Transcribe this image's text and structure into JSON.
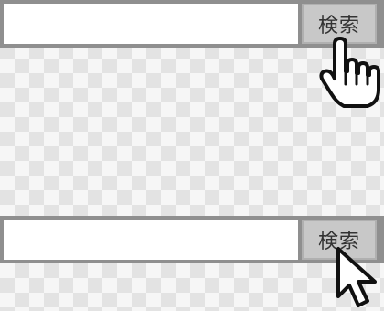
{
  "search_bars": [
    {
      "input_value": "",
      "button_label": "検索",
      "cursor_icon": "hand-pointer-icon"
    },
    {
      "input_value": "",
      "button_label": "検索",
      "cursor_icon": "arrow-pointer-icon"
    }
  ]
}
